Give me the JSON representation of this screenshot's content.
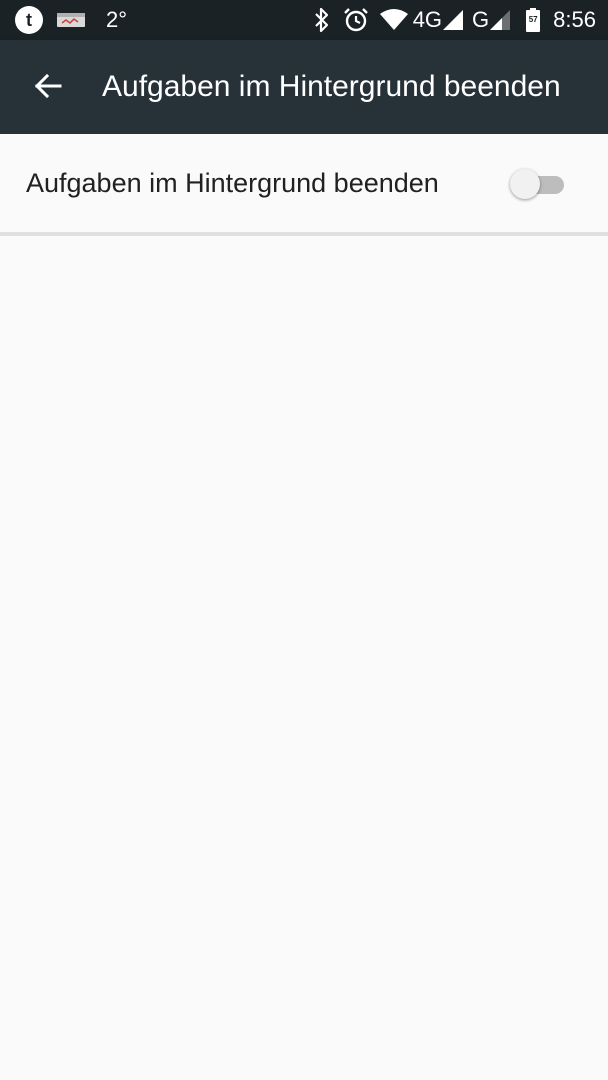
{
  "status_bar": {
    "temperature": "2°",
    "network_4g": "4G",
    "network_g": "G",
    "battery_level": "57",
    "time": "8:56",
    "icons": [
      "tumblr-icon",
      "card-icon",
      "bluetooth-icon",
      "alarm-icon",
      "wifi-icon",
      "signal-icon",
      "battery-icon"
    ]
  },
  "toolbar": {
    "title": "Aufgaben im Hintergrund beenden",
    "back_icon": "arrow-left-icon",
    "background": "#263238"
  },
  "setting": {
    "label": "Aufgaben im Hintergrund beenden",
    "toggle_on": false
  },
  "colors": {
    "status_bar": "#1b2226",
    "page_background": "#fafafa",
    "switch_track_off": "#bdbdbd",
    "switch_thumb_off": "#f1f1f1"
  }
}
